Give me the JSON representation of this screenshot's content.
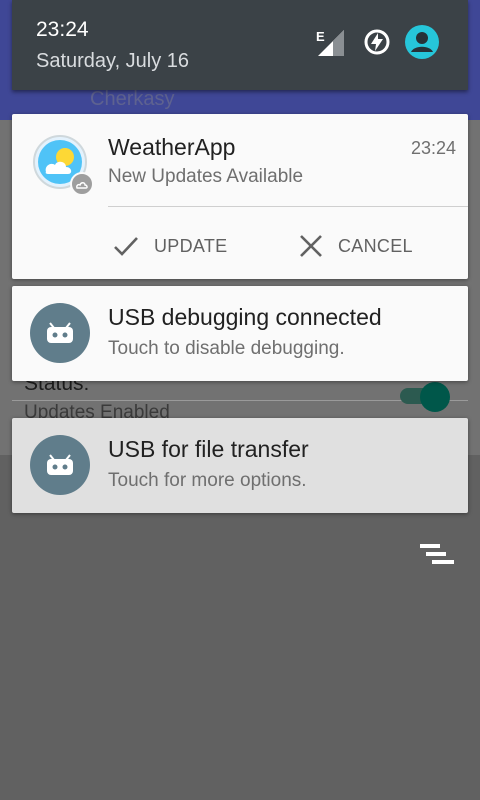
{
  "background_app": {
    "city": "Cherkasy",
    "status_label": "Status:",
    "updates_label": "Updates Enabled"
  },
  "header": {
    "time": "23:24",
    "date": "Saturday, July 16",
    "icons": [
      "signal-e-icon",
      "battery-charging-icon",
      "user-account-icon"
    ]
  },
  "notifications": [
    {
      "app_name": "WeatherApp",
      "time": "23:24",
      "text": "New Updates Available",
      "actions": [
        {
          "icon": "check-icon",
          "label": "UPDATE"
        },
        {
          "icon": "close-icon",
          "label": "CANCEL"
        }
      ]
    },
    {
      "title": "USB debugging connected",
      "text": "Touch to disable debugging."
    },
    {
      "title": "USB for file transfer",
      "text": "Touch for more options."
    }
  ],
  "colors": {
    "scrim": "#616161",
    "header_bg": "#3b4247",
    "accent_user": "#26c6da",
    "usb_icon_bg": "#607d8b"
  }
}
